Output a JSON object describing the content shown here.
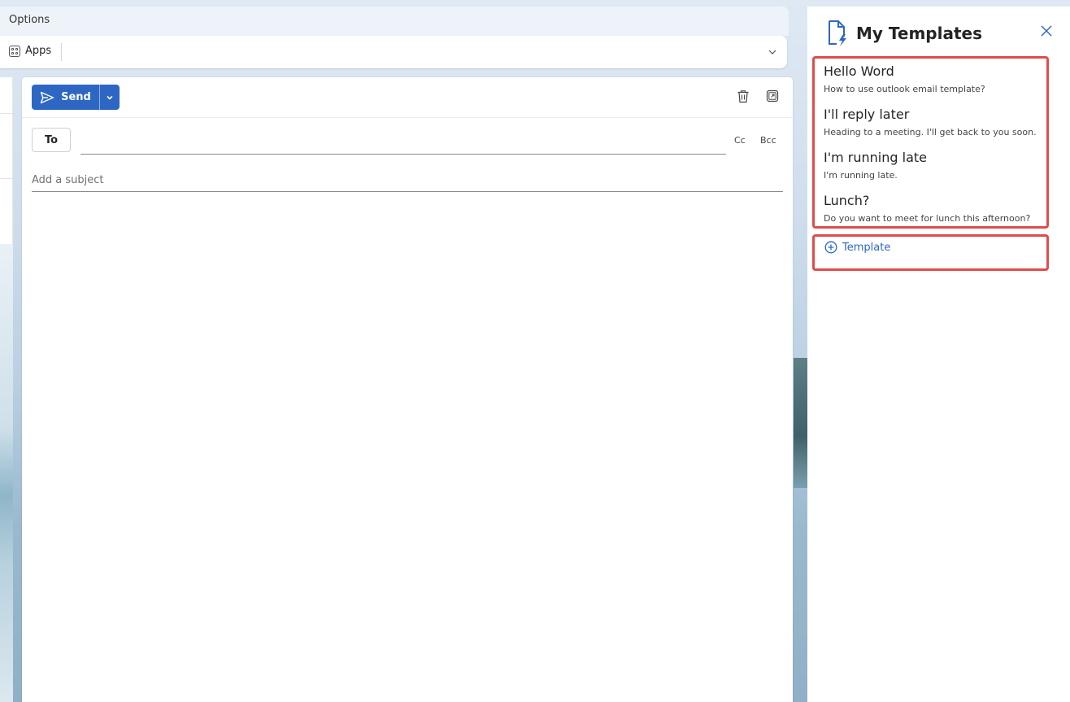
{
  "ribbon": {
    "tab_label": "Options",
    "apps_label": "Apps"
  },
  "compose": {
    "send_label": "Send",
    "to_label": "To",
    "to_value": "",
    "cc_label": "Cc",
    "bcc_label": "Bcc",
    "subject_placeholder": "Add a subject",
    "subject_value": ""
  },
  "panel": {
    "title": "My Templates",
    "templates": [
      {
        "title": "Hello Word",
        "description": "How to use outlook email template?"
      },
      {
        "title": "I'll reply later",
        "description": "Heading to a meeting. I'll get back to you soon."
      },
      {
        "title": "I'm running late",
        "description": "I'm running late."
      },
      {
        "title": "Lunch?",
        "description": "Do you want to meet for lunch this afternoon?"
      }
    ],
    "add_label": "Template"
  },
  "colors": {
    "accent": "#2d67c3",
    "highlight": "#e04c4c"
  },
  "icons": [
    "apps-icon",
    "chevron-down-icon",
    "send-icon",
    "delete-icon",
    "popout-icon",
    "template-logo-icon",
    "close-icon",
    "add-circle-icon"
  ]
}
